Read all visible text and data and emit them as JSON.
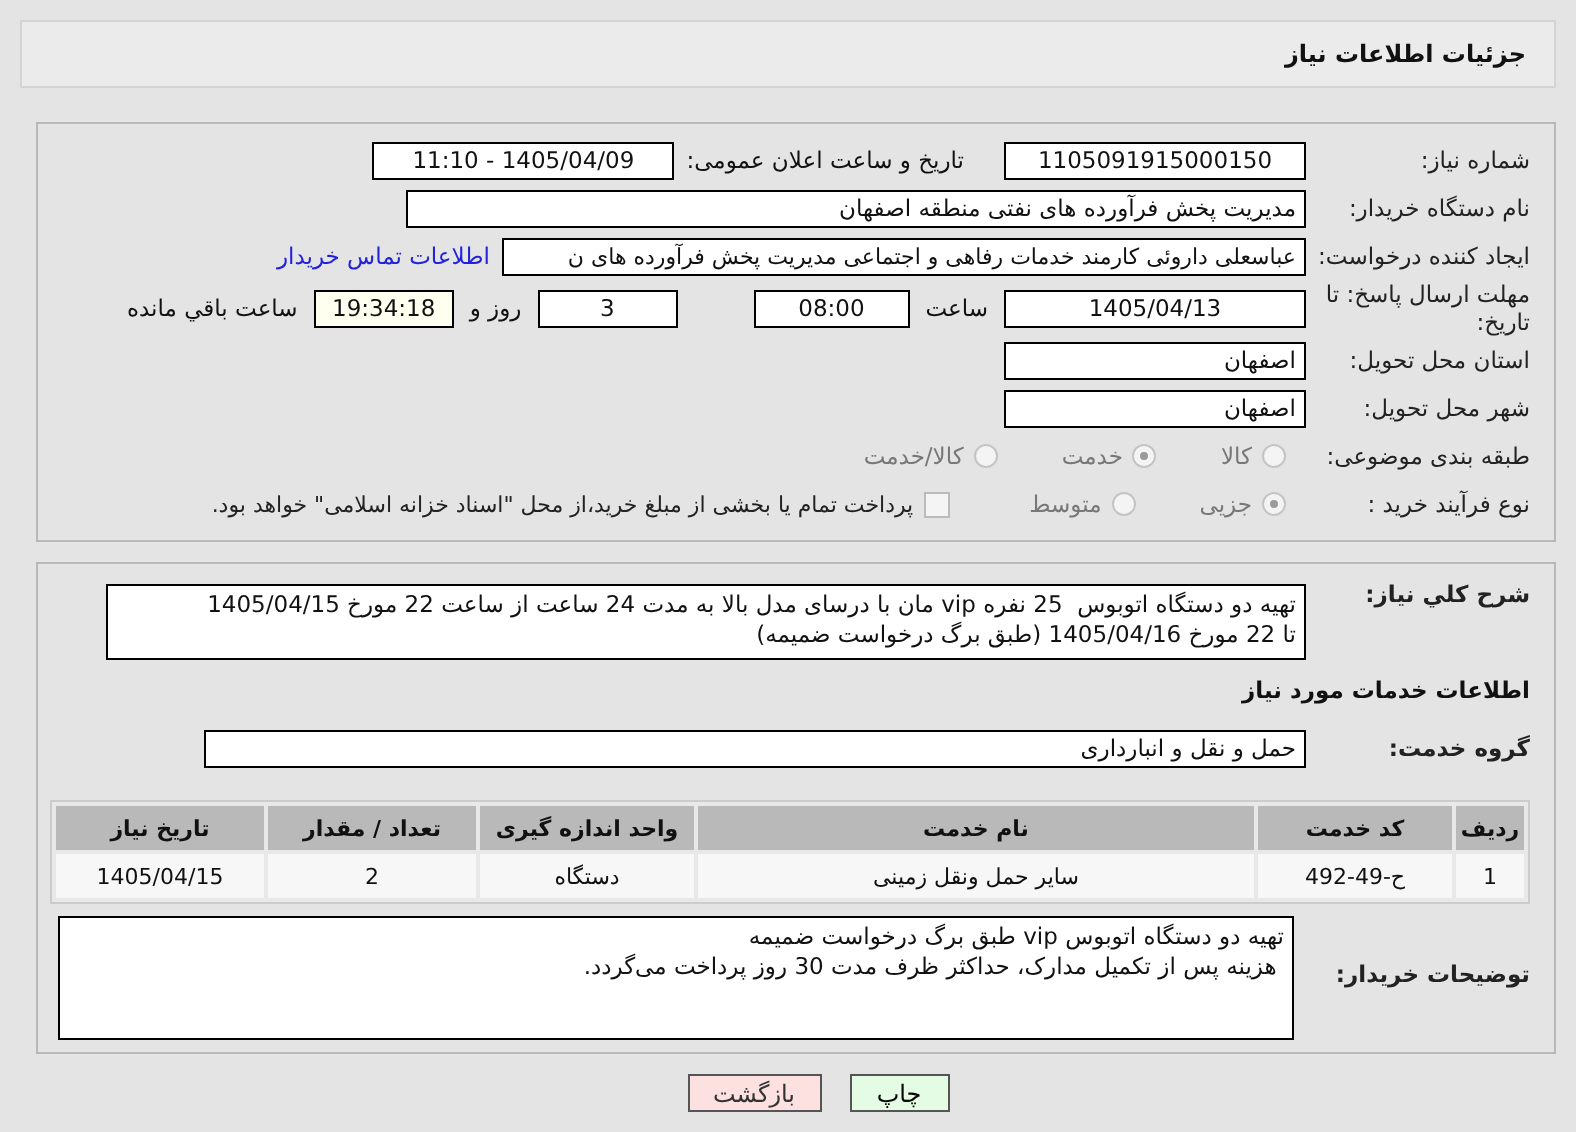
{
  "header": {
    "title": "جزئیات اطلاعات نیاز"
  },
  "need_number": {
    "label": "شماره نیاز:",
    "value": "1105091915000150"
  },
  "announce": {
    "label": "تاریخ و ساعت اعلان عمومی:",
    "value": "1405/04/09 - 11:10"
  },
  "buyer": {
    "label": "نام دستگاه خریدار:",
    "value": "مدیریت پخش فرآورده های نفتی منطقه اصفهان"
  },
  "creator": {
    "label": "ایجاد کننده درخواست:",
    "value": "عباسعلی داروئی کارمند خدمات رفاهی و اجتماعی مدیریت پخش فرآورده های ن",
    "link": "اطلاعات تماس خریدار"
  },
  "deadline": {
    "label": "مهلت ارسال پاسخ: تا تاریخ:",
    "date": "1405/04/13",
    "time_label": "ساعت",
    "time": "08:00",
    "days": "3",
    "days_label": "روز و",
    "remaining": "19:34:18",
    "remaining_label": "ساعت باقي مانده"
  },
  "province": {
    "label": "استان محل تحویل:",
    "value": "اصفهان"
  },
  "city": {
    "label": "شهر محل تحویل:",
    "value": "اصفهان"
  },
  "category": {
    "label": "طبقه بندی موضوعی:",
    "options": [
      {
        "label": "کالا",
        "selected": false
      },
      {
        "label": "خدمت",
        "selected": true
      },
      {
        "label": "کالا/خدمت",
        "selected": false
      }
    ]
  },
  "process": {
    "label": "نوع فرآیند خرید :",
    "options": [
      {
        "label": "جزیی",
        "selected": true
      },
      {
        "label": "متوسط",
        "selected": false
      }
    ],
    "treasury": {
      "checked": false,
      "label": "پرداخت تمام یا بخشی از مبلغ خرید،از محل \"اسناد خزانه اسلامی\" خواهد بود."
    }
  },
  "description": {
    "label": "شرح کلي نیاز:",
    "lines": [
      "تهیه دو دستگاه اتوبوس  25 نفره vip مان با درسای مدل بالا به مدت 24 ساعت از ساعت 22 مورخ 1405/04/15",
      "تا 22 مورخ 1405/04/16 (طبق برگ درخواست ضمیمه)"
    ]
  },
  "services_heading": "اطلاعات خدمات مورد نیاز",
  "service_group": {
    "label": "گروه خدمت:",
    "value": "حمل و نقل و انبارداری"
  },
  "table": {
    "columns": [
      "ردیف",
      "کد خدمت",
      "نام خدمت",
      "واحد اندازه گیری",
      "تعداد / مقدار",
      "تاریخ نیاز"
    ],
    "rows": [
      [
        "1",
        "ح-49-492",
        "سایر حمل ونقل زمینی",
        "دستگاه",
        "2",
        "1405/04/15"
      ]
    ]
  },
  "buyer_notes": {
    "label": "توضیحات خریدار:",
    "lines": [
      "تهیه دو دستگاه اتوبوس vip طبق برگ درخواست ضمیمه",
      " هزینه پس از تکمیل مدارک، حداکثر ظرف مدت 30 روز پرداخت می‌گردد."
    ]
  },
  "buttons": [
    {
      "label": "چاپ",
      "kind": "print"
    },
    {
      "label": "بازگشت",
      "kind": "back"
    }
  ]
}
